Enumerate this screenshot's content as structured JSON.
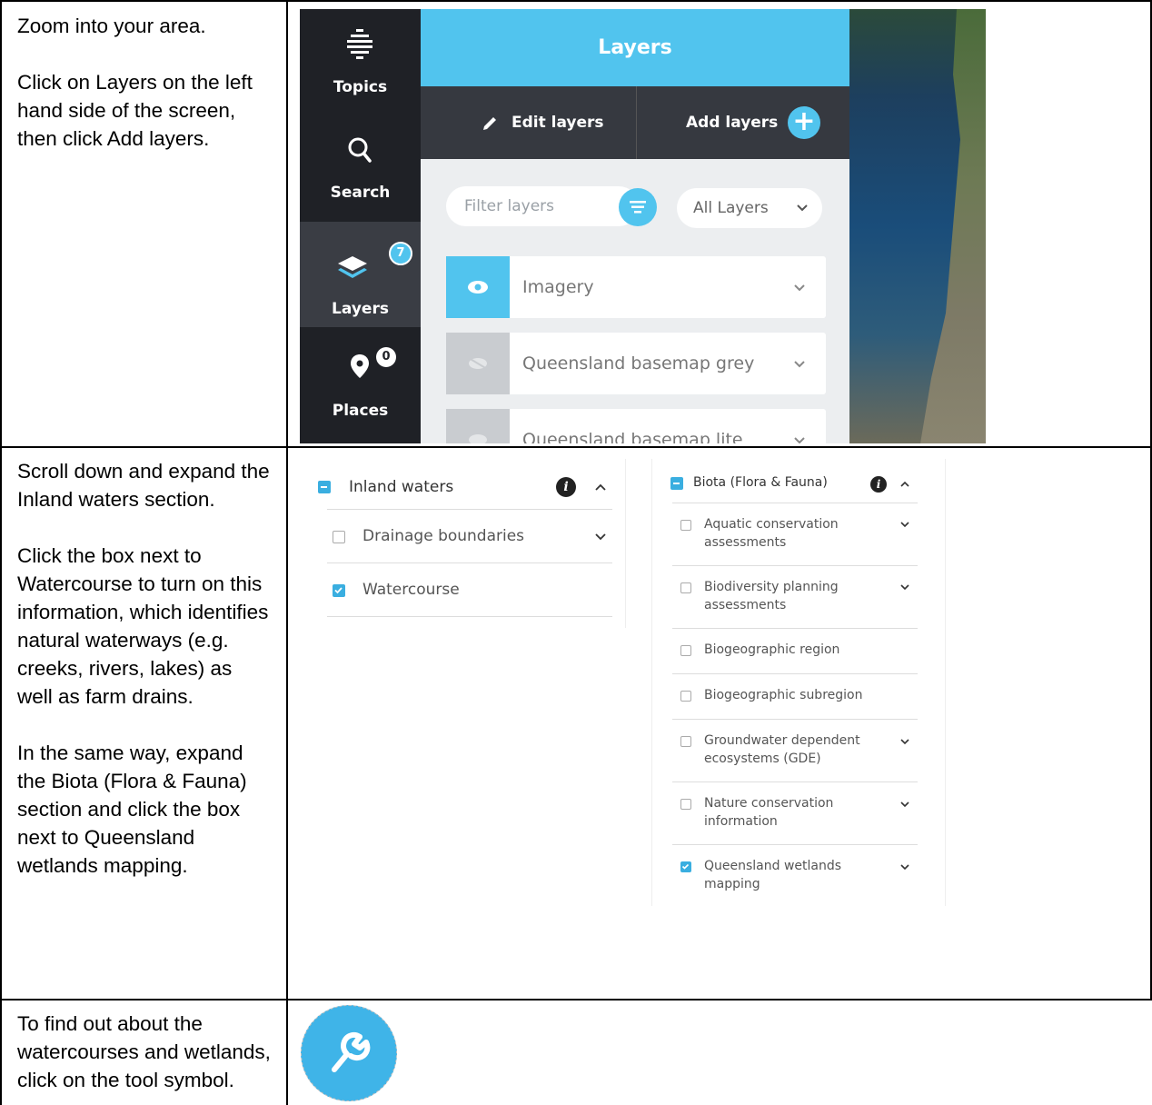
{
  "rows": [
    {
      "instructions": [
        "Zoom into your area.",
        "Click on Layers on the left hand side of the screen, then click Add layers."
      ]
    },
    {
      "instructions": [
        "Scroll down and expand the Inland waters section.",
        "Click the box next to Watercourse to turn on this information, which identifies natural waterways (e.g. creeks, rivers, lakes) as well as farm drains.",
        "In the same way, expand the Biota (Flora & Fauna) section and click the box next to Queensland wetlands mapping."
      ]
    },
    {
      "instructions": [
        "To find out about the watercourses and wetlands, click on the tool symbol."
      ]
    }
  ],
  "app": {
    "nav": {
      "topics": "Topics",
      "search": "Search",
      "layers": "Layers",
      "layers_badge": "7",
      "places": "Places",
      "places_badge": "0"
    },
    "panel": {
      "title": "Layers",
      "edit_layers": "Edit layers",
      "add_layers": "Add layers",
      "filter_placeholder": "Filter layers",
      "dropdown_value": "All Layers",
      "layers": [
        "Imagery",
        "Queensland basemap grey",
        "Queensland basemap lite"
      ]
    },
    "colors": {
      "accent": "#51c4ee",
      "nav_bg": "#1f2126",
      "action_bar": "#363940"
    }
  },
  "inland": {
    "header": "Inland waters",
    "items": [
      {
        "label": "Drainage boundaries",
        "checked": false
      },
      {
        "label": "Watercourse",
        "checked": true
      }
    ]
  },
  "biota": {
    "header": "Biota (Flora & Fauna)",
    "items": [
      {
        "line1": "Aquatic conservation",
        "line2": "assessments",
        "checked": false
      },
      {
        "line1": "Biodiversity planning",
        "line2": "assessments",
        "checked": false
      },
      {
        "line1": "Biogeographic region",
        "line2": "",
        "checked": false
      },
      {
        "line1": "Biogeographic subregion",
        "line2": "",
        "checked": false
      },
      {
        "line1": "Groundwater dependent",
        "line2": "ecosystems (GDE)",
        "checked": false
      },
      {
        "line1": "Nature conservation",
        "line2": "information",
        "checked": false
      },
      {
        "line1": "Queensland wetlands",
        "line2": "mapping",
        "checked": true
      }
    ]
  }
}
